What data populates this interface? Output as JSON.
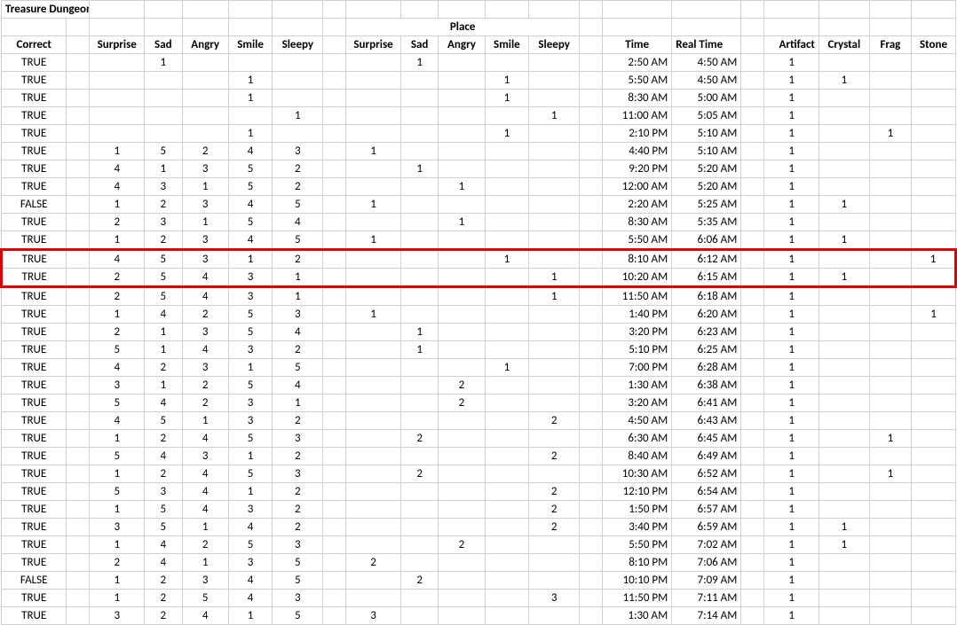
{
  "title": "Treasure Dungeon",
  "merged_header": "Place",
  "headers": {
    "correct": "Correct",
    "surprise": "Surprise",
    "sad": "Sad",
    "angry": "Angry",
    "smile": "Smile",
    "sleepy": "Sleepy",
    "time": "Time",
    "realtime": "Real Time",
    "artifact": "Artifact",
    "crystal": "Crystal",
    "frag": "Frag",
    "stone": "Stone"
  },
  "highlight_rows": [
    11,
    12
  ],
  "rows": [
    {
      "correct": "TRUE",
      "a": [
        "",
        "1",
        "",
        "",
        ""
      ],
      "b": [
        "",
        "1",
        "",
        "",
        ""
      ],
      "time": "2:50 AM",
      "rt": "4:50 AM",
      "art": "1",
      "cry": "",
      "frag": "",
      "stone": ""
    },
    {
      "correct": "TRUE",
      "a": [
        "",
        "",
        "",
        "1",
        ""
      ],
      "b": [
        "",
        "",
        "",
        "1",
        ""
      ],
      "time": "5:50 AM",
      "rt": "4:50 AM",
      "art": "1",
      "cry": "1",
      "frag": "",
      "stone": ""
    },
    {
      "correct": "TRUE",
      "a": [
        "",
        "",
        "",
        "1",
        ""
      ],
      "b": [
        "",
        "",
        "",
        "1",
        ""
      ],
      "time": "8:30 AM",
      "rt": "5:00 AM",
      "art": "1",
      "cry": "",
      "frag": "",
      "stone": ""
    },
    {
      "correct": "TRUE",
      "a": [
        "",
        "",
        "",
        "",
        "1"
      ],
      "b": [
        "",
        "",
        "",
        "",
        "1"
      ],
      "time": "11:00 AM",
      "rt": "5:05 AM",
      "art": "1",
      "cry": "",
      "frag": "",
      "stone": ""
    },
    {
      "correct": "TRUE",
      "a": [
        "",
        "",
        "",
        "1",
        ""
      ],
      "b": [
        "",
        "",
        "",
        "1",
        ""
      ],
      "time": "2:10 PM",
      "rt": "5:10 AM",
      "art": "1",
      "cry": "",
      "frag": "1",
      "stone": ""
    },
    {
      "correct": "TRUE",
      "a": [
        "1",
        "5",
        "2",
        "4",
        "3"
      ],
      "b": [
        "1",
        "",
        "",
        "",
        ""
      ],
      "time": "4:40 PM",
      "rt": "5:10 AM",
      "art": "1",
      "cry": "",
      "frag": "",
      "stone": ""
    },
    {
      "correct": "TRUE",
      "a": [
        "4",
        "1",
        "3",
        "5",
        "2"
      ],
      "b": [
        "",
        "1",
        "",
        "",
        ""
      ],
      "time": "9:20 PM",
      "rt": "5:20 AM",
      "art": "1",
      "cry": "",
      "frag": "",
      "stone": ""
    },
    {
      "correct": "TRUE",
      "a": [
        "4",
        "3",
        "1",
        "5",
        "2"
      ],
      "b": [
        "",
        "",
        "1",
        "",
        ""
      ],
      "time": "12:00 AM",
      "rt": "5:20 AM",
      "art": "1",
      "cry": "",
      "frag": "",
      "stone": ""
    },
    {
      "correct": "FALSE",
      "a": [
        "1",
        "2",
        "3",
        "4",
        "5"
      ],
      "b": [
        "1",
        "",
        "",
        "",
        ""
      ],
      "time": "2:20 AM",
      "rt": "5:25 AM",
      "art": "1",
      "cry": "1",
      "frag": "",
      "stone": ""
    },
    {
      "correct": "TRUE",
      "a": [
        "2",
        "3",
        "1",
        "5",
        "4"
      ],
      "b": [
        "",
        "",
        "1",
        "",
        ""
      ],
      "time": "8:30 AM",
      "rt": "5:35 AM",
      "art": "1",
      "cry": "",
      "frag": "",
      "stone": ""
    },
    {
      "correct": "TRUE",
      "a": [
        "1",
        "2",
        "3",
        "4",
        "5"
      ],
      "b": [
        "1",
        "",
        "",
        "",
        ""
      ],
      "time": "5:50 AM",
      "rt": "6:06 AM",
      "art": "1",
      "cry": "1",
      "frag": "",
      "stone": ""
    },
    {
      "correct": "TRUE",
      "a": [
        "4",
        "5",
        "3",
        "1",
        "2"
      ],
      "b": [
        "",
        "",
        "",
        "1",
        ""
      ],
      "time": "8:10 AM",
      "rt": "6:12 AM",
      "art": "1",
      "cry": "",
      "frag": "",
      "stone": "1"
    },
    {
      "correct": "TRUE",
      "a": [
        "2",
        "5",
        "4",
        "3",
        "1"
      ],
      "b": [
        "",
        "",
        "",
        "",
        "1"
      ],
      "time": "10:20 AM",
      "rt": "6:15 AM",
      "art": "1",
      "cry": "1",
      "frag": "",
      "stone": ""
    },
    {
      "correct": "TRUE",
      "a": [
        "2",
        "5",
        "4",
        "3",
        "1"
      ],
      "b": [
        "",
        "",
        "",
        "",
        "1"
      ],
      "time": "11:50 AM",
      "rt": "6:18 AM",
      "art": "1",
      "cry": "",
      "frag": "",
      "stone": ""
    },
    {
      "correct": "TRUE",
      "a": [
        "1",
        "4",
        "2",
        "5",
        "3"
      ],
      "b": [
        "1",
        "",
        "",
        "",
        ""
      ],
      "time": "1:40 PM",
      "rt": "6:20 AM",
      "art": "1",
      "cry": "",
      "frag": "",
      "stone": "1"
    },
    {
      "correct": "TRUE",
      "a": [
        "2",
        "1",
        "3",
        "5",
        "4"
      ],
      "b": [
        "",
        "1",
        "",
        "",
        ""
      ],
      "time": "3:20 PM",
      "rt": "6:23 AM",
      "art": "1",
      "cry": "",
      "frag": "",
      "stone": ""
    },
    {
      "correct": "TRUE",
      "a": [
        "5",
        "1",
        "4",
        "3",
        "2"
      ],
      "b": [
        "",
        "1",
        "",
        "",
        ""
      ],
      "time": "5:10 PM",
      "rt": "6:25 AM",
      "art": "1",
      "cry": "",
      "frag": "",
      "stone": ""
    },
    {
      "correct": "TRUE",
      "a": [
        "4",
        "2",
        "3",
        "1",
        "5"
      ],
      "b": [
        "",
        "",
        "",
        "1",
        ""
      ],
      "time": "7:00 PM",
      "rt": "6:28 AM",
      "art": "1",
      "cry": "",
      "frag": "",
      "stone": ""
    },
    {
      "correct": "TRUE",
      "a": [
        "3",
        "1",
        "2",
        "5",
        "4"
      ],
      "b": [
        "",
        "",
        "2",
        "",
        ""
      ],
      "time": "1:30 AM",
      "rt": "6:38 AM",
      "art": "1",
      "cry": "",
      "frag": "",
      "stone": ""
    },
    {
      "correct": "TRUE",
      "a": [
        "5",
        "4",
        "2",
        "3",
        "1"
      ],
      "b": [
        "",
        "",
        "2",
        "",
        ""
      ],
      "time": "3:20 AM",
      "rt": "6:41 AM",
      "art": "1",
      "cry": "",
      "frag": "",
      "stone": ""
    },
    {
      "correct": "TRUE",
      "a": [
        "4",
        "5",
        "1",
        "3",
        "2"
      ],
      "b": [
        "",
        "",
        "",
        "",
        "2"
      ],
      "time": "4:50 AM",
      "rt": "6:43 AM",
      "art": "1",
      "cry": "",
      "frag": "",
      "stone": ""
    },
    {
      "correct": "TRUE",
      "a": [
        "1",
        "2",
        "4",
        "5",
        "3"
      ],
      "b": [
        "",
        "2",
        "",
        "",
        ""
      ],
      "time": "6:30 AM",
      "rt": "6:45 AM",
      "art": "1",
      "cry": "",
      "frag": "1",
      "stone": ""
    },
    {
      "correct": "TRUE",
      "a": [
        "5",
        "4",
        "3",
        "1",
        "2"
      ],
      "b": [
        "",
        "",
        "",
        "",
        "2"
      ],
      "time": "8:40 AM",
      "rt": "6:49 AM",
      "art": "1",
      "cry": "",
      "frag": "",
      "stone": ""
    },
    {
      "correct": "TRUE",
      "a": [
        "1",
        "2",
        "4",
        "5",
        "3"
      ],
      "b": [
        "",
        "2",
        "",
        "",
        ""
      ],
      "time": "10:30 AM",
      "rt": "6:52 AM",
      "art": "1",
      "cry": "",
      "frag": "1",
      "stone": ""
    },
    {
      "correct": "TRUE",
      "a": [
        "5",
        "3",
        "4",
        "1",
        "2"
      ],
      "b": [
        "",
        "",
        "",
        "",
        "2"
      ],
      "time": "12:10 PM",
      "rt": "6:54 AM",
      "art": "1",
      "cry": "",
      "frag": "",
      "stone": ""
    },
    {
      "correct": "TRUE",
      "a": [
        "1",
        "5",
        "4",
        "3",
        "2"
      ],
      "b": [
        "",
        "",
        "",
        "",
        "2"
      ],
      "time": "1:50 PM",
      "rt": "6:57 AM",
      "art": "1",
      "cry": "",
      "frag": "",
      "stone": ""
    },
    {
      "correct": "TRUE",
      "a": [
        "3",
        "5",
        "1",
        "4",
        "2"
      ],
      "b": [
        "",
        "",
        "",
        "",
        "2"
      ],
      "time": "3:40 PM",
      "rt": "6:59 AM",
      "art": "1",
      "cry": "1",
      "frag": "",
      "stone": ""
    },
    {
      "correct": "TRUE",
      "a": [
        "1",
        "4",
        "2",
        "5",
        "3"
      ],
      "b": [
        "",
        "",
        "2",
        "",
        ""
      ],
      "time": "5:50 PM",
      "rt": "7:02 AM",
      "art": "1",
      "cry": "1",
      "frag": "",
      "stone": ""
    },
    {
      "correct": "TRUE",
      "a": [
        "2",
        "4",
        "1",
        "3",
        "5"
      ],
      "b": [
        "2",
        "",
        "",
        "",
        ""
      ],
      "time": "8:10 PM",
      "rt": "7:06 AM",
      "art": "1",
      "cry": "",
      "frag": "",
      "stone": ""
    },
    {
      "correct": "FALSE",
      "a": [
        "1",
        "2",
        "3",
        "4",
        "5"
      ],
      "b": [
        "",
        "2",
        "",
        "",
        ""
      ],
      "time": "10:10 PM",
      "rt": "7:09 AM",
      "art": "1",
      "cry": "",
      "frag": "",
      "stone": ""
    },
    {
      "correct": "TRUE",
      "a": [
        "1",
        "2",
        "5",
        "4",
        "3"
      ],
      "b": [
        "",
        "",
        "",
        "",
        "3"
      ],
      "time": "11:50 PM",
      "rt": "7:11 AM",
      "art": "1",
      "cry": "",
      "frag": "",
      "stone": ""
    },
    {
      "correct": "TRUE",
      "a": [
        "3",
        "2",
        "4",
        "1",
        "5"
      ],
      "b": [
        "3",
        "",
        "",
        "",
        ""
      ],
      "time": "1:30 AM",
      "rt": "7:14 AM",
      "art": "1",
      "cry": "",
      "frag": "",
      "stone": ""
    }
  ]
}
